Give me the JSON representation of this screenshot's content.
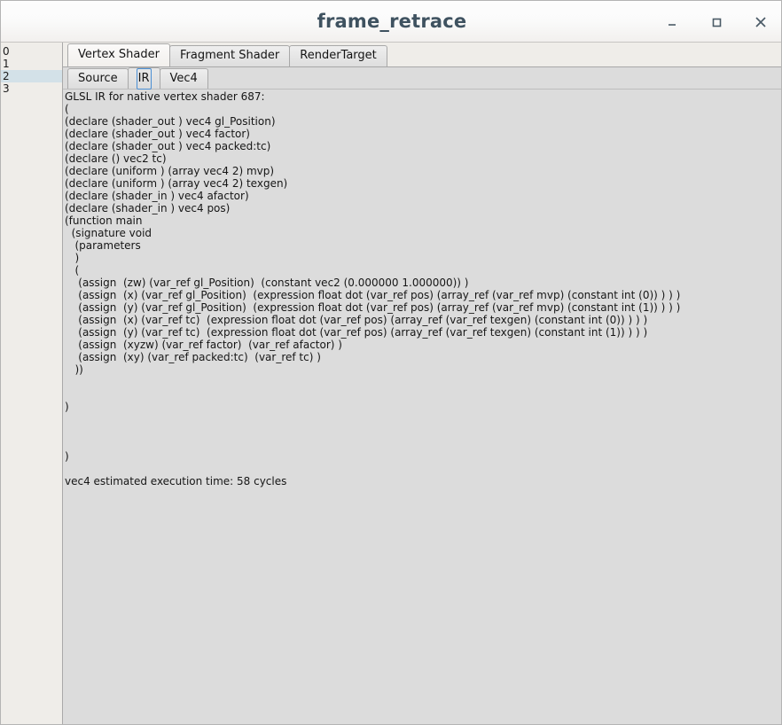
{
  "window": {
    "title": "frame_retrace",
    "controls": [
      {
        "name": "minimize-button",
        "glyph": "minimize"
      },
      {
        "name": "maximize-button",
        "glyph": "maximize"
      },
      {
        "name": "close-button",
        "glyph": "close"
      }
    ]
  },
  "sidebar": {
    "rows": [
      {
        "label": "0",
        "selected": false
      },
      {
        "label": "1",
        "selected": false
      },
      {
        "label": "2",
        "selected": true
      },
      {
        "label": "3",
        "selected": false
      }
    ]
  },
  "tabs_outer": [
    {
      "label": "Vertex Shader",
      "active": true
    },
    {
      "label": "Fragment Shader",
      "active": false
    },
    {
      "label": "RenderTarget",
      "active": false
    }
  ],
  "tabs_inner": [
    {
      "label": "Source",
      "active": false
    },
    {
      "label": "IR",
      "active": true
    },
    {
      "label": "Vec4",
      "active": false
    }
  ],
  "content": {
    "ir_text": "GLSL IR for native vertex shader 687:\n(\n(declare (shader_out ) vec4 gl_Position)\n(declare (shader_out ) vec4 factor)\n(declare (shader_out ) vec4 packed:tc)\n(declare () vec2 tc)\n(declare (uniform ) (array vec4 2) mvp)\n(declare (uniform ) (array vec4 2) texgen)\n(declare (shader_in ) vec4 afactor)\n(declare (shader_in ) vec4 pos)\n(function main\n  (signature void\n   (parameters\n   )\n   (\n    (assign  (zw) (var_ref gl_Position)  (constant vec2 (0.000000 1.000000)) )\n    (assign  (x) (var_ref gl_Position)  (expression float dot (var_ref pos) (array_ref (var_ref mvp) (constant int (0)) ) ) )\n    (assign  (y) (var_ref gl_Position)  (expression float dot (var_ref pos) (array_ref (var_ref mvp) (constant int (1)) ) ) )\n    (assign  (x) (var_ref tc)  (expression float dot (var_ref pos) (array_ref (var_ref texgen) (constant int (0)) ) ) )\n    (assign  (y) (var_ref tc)  (expression float dot (var_ref pos) (array_ref (var_ref texgen) (constant int (1)) ) ) )\n    (assign  (xyzw) (var_ref factor)  (var_ref afactor) )\n    (assign  (xy) (var_ref packed:tc)  (var_ref tc) )\n   ))\n\n\n)\n\n\n\n)\n\nvec4 estimated execution time: 58 cycles"
  }
}
